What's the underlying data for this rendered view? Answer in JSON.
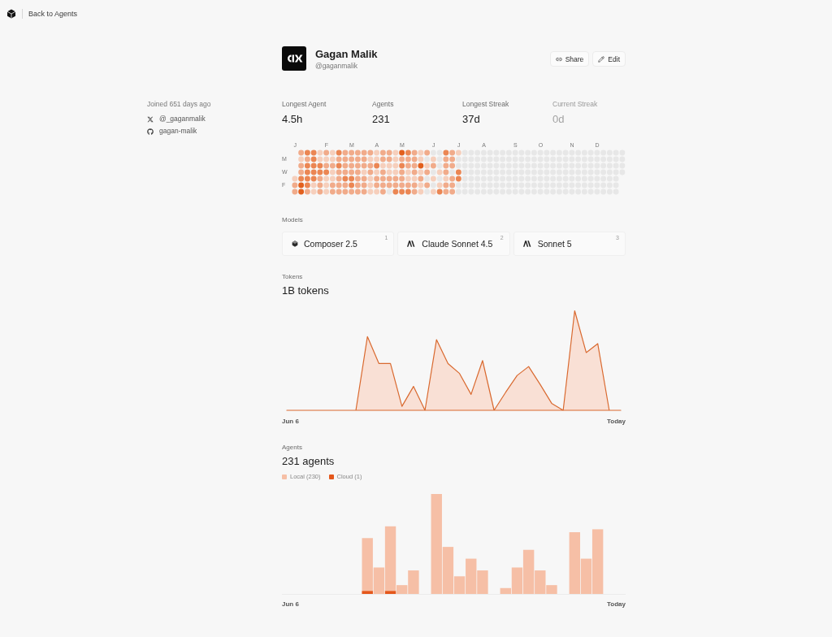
{
  "nav": {
    "back_link": "Back to Agents"
  },
  "profile": {
    "name": "Gagan Malik",
    "handle": "@gaganmalik",
    "actions": [
      {
        "kind": "link",
        "label": "Share"
      },
      {
        "kind": "pencil",
        "label": "Edit"
      }
    ]
  },
  "sidebar": {
    "joined": "Joined 651 days ago",
    "accounts": [
      {
        "kind": "x",
        "handle": "@_gaganmalik"
      },
      {
        "kind": "github",
        "handle": "gagan-malik"
      }
    ]
  },
  "stats": [
    {
      "label": "Longest Agent",
      "value": "4.5h",
      "dimmed": false
    },
    {
      "label": "Agents",
      "value": "231",
      "dimmed": false
    },
    {
      "label": "Longest Streak",
      "value": "37d",
      "dimmed": false
    },
    {
      "label": "Current Streak",
      "value": "0d",
      "dimmed": true
    }
  ],
  "heatmap": {
    "day_labels": [
      "M",
      "W",
      "F"
    ],
    "weeks": [
      {
        "month": "J",
        "days": [
          {
            "color": "#f6cfbc"
          },
          {
            "color": "#f1ab8a"
          },
          {
            "color": "#f1ab8a"
          }
        ]
      },
      {
        "days": [
          {
            "color": "#f1ab8a"
          },
          {
            "color": "#f6cfbc"
          },
          {
            "color": "#f1ab8a"
          },
          {
            "color": "#f1ab8a"
          },
          {
            "color": "#eb8653"
          },
          {
            "color": "#e2601e"
          },
          {
            "color": "#e2601e"
          }
        ]
      },
      {
        "days": [
          {
            "color": "#eb8653"
          },
          {
            "color": "#f1ab8a"
          },
          {
            "color": "#eb8653"
          },
          {
            "color": "#eb8653"
          },
          {
            "color": "#eb8653"
          },
          {
            "color": "#eb8653"
          },
          {
            "color": "#f1ab8a"
          }
        ]
      },
      {
        "days": [
          {
            "color": "#eb8653"
          },
          {
            "color": "#eb8653"
          },
          {
            "color": "#eb8653"
          },
          {
            "color": "#eb8653"
          },
          {
            "color": "#eb8653"
          },
          {
            "color": "#f6cfbc"
          },
          {
            "color": "#f6cfbc"
          }
        ]
      },
      {
        "days": [
          {
            "color": "#f6cfbc"
          },
          {
            "color": "#f6cfbc"
          },
          {
            "color": "#eb8653"
          },
          {
            "color": "#eb8653"
          },
          {
            "color": "#f1ab8a"
          },
          {
            "color": "#f1ab8a"
          },
          {
            "color": "#f1ab8a"
          }
        ]
      },
      {
        "month": "F",
        "days": [
          {
            "color": "#f1ab8a"
          },
          {
            "color": "#f6cfbc"
          },
          {
            "color": "#f1ab8a"
          },
          {
            "color": "#eb8653"
          },
          {
            "color": "#f6cfbc"
          },
          {
            "color": "#f6cfbc"
          },
          {
            "color": "#f6cfbc"
          }
        ]
      },
      {
        "days": [
          {
            "color": "#f6cfbc"
          },
          {
            "color": "#f6cfbc"
          },
          {
            "color": "#f1ab8a"
          },
          {
            "color": "#f6cfbc"
          },
          {
            "color": "#f6cfbc"
          },
          {
            "color": "#f1ab8a"
          },
          {
            "color": "#f1ab8a"
          }
        ]
      },
      {
        "days": [
          {
            "color": "#eb8653"
          },
          {
            "color": "#f1ab8a"
          },
          {
            "color": "#eb8653"
          },
          {
            "color": "#f1ab8a"
          },
          {
            "color": "#f1ab8a"
          },
          {
            "color": "#f1ab8a"
          },
          {
            "color": "#f1ab8a"
          }
        ]
      },
      {
        "days": [
          {
            "color": "#f1ab8a"
          },
          {
            "color": "#f1ab8a"
          },
          {
            "color": "#f1ab8a"
          },
          {
            "color": "#f1ab8a"
          },
          {
            "color": "#eb8653"
          },
          {
            "color": "#f1ab8a"
          },
          {
            "color": "#f1ab8a"
          }
        ]
      },
      {
        "month": "M",
        "days": [
          {
            "color": "#f1ab8a"
          },
          {
            "color": "#f1ab8a"
          },
          {
            "color": "#f1ab8a"
          },
          {
            "color": "#f1ab8a"
          },
          {
            "color": "#eb8653"
          },
          {
            "color": "#eb8653"
          },
          {
            "color": "#f1ab8a"
          }
        ]
      },
      {
        "days": [
          {
            "color": "#f1ab8a"
          },
          {
            "color": "#f1ab8a"
          },
          {
            "color": "#f1ab8a"
          },
          {
            "color": "#f1ab8a"
          },
          {
            "color": "#f1ab8a"
          },
          {
            "color": "#f1ab8a"
          },
          {
            "color": "#f1ab8a"
          }
        ]
      },
      {
        "days": [
          {
            "color": "#f1ab8a"
          },
          {
            "color": "#f1ab8a"
          },
          {
            "color": "#f1ab8a"
          },
          {
            "color": "#f6cfbc"
          },
          {
            "color": "#f1ab8a"
          },
          {
            "color": "#f1ab8a"
          },
          {
            "color": "#f1ab8a"
          }
        ]
      },
      {
        "days": [
          {
            "color": "#f1ab8a"
          },
          {
            "color": "#f6cfbc"
          },
          {
            "color": "#f1ab8a"
          },
          {
            "color": "#f1ab8a"
          },
          {
            "color": "#f6cfbc"
          },
          {
            "color": "#f6cfbc"
          },
          {
            "color": "#f6cfbc"
          }
        ]
      },
      {
        "month": "A",
        "days": [
          {
            "color": "#f6cfbc"
          },
          {
            "color": "#f6cfbc"
          },
          {
            "color": "#eb8653"
          },
          {
            "color": "#f6cfbc"
          },
          {
            "color": "#f1ab8a"
          },
          {
            "color": "#f1ab8a"
          },
          {
            "color": "#f6cfbc"
          }
        ]
      },
      {
        "days": [
          {
            "color": "#f1ab8a"
          },
          {
            "color": "#f1ab8a"
          },
          {
            "color": "#f6cfbc"
          },
          {
            "color": "#f1ab8a"
          },
          {
            "color": "#f1ab8a"
          },
          {
            "color": "#f1ab8a"
          },
          {
            "color": "#f1ab8a"
          }
        ]
      },
      {
        "days": [
          {
            "color": "#f1ab8a"
          },
          {
            "color": "#f1ab8a"
          },
          {
            "color": "#f6cfbc"
          },
          {
            "color": "#f6cfbc"
          },
          {
            "color": "#f1ab8a"
          },
          {
            "color": "#f1ab8a"
          },
          {
            "color": "#e7e7e7"
          }
        ]
      },
      {
        "days": [
          {
            "color": "#f6cfbc"
          },
          {
            "color": "#f6cfbc"
          },
          {
            "color": "#f6cfbc"
          },
          {
            "color": "#f6cfbc"
          },
          {
            "color": "#f1ab8a"
          },
          {
            "color": "#f1ab8a"
          },
          {
            "color": "#eb8653"
          }
        ]
      },
      {
        "month": "M",
        "days": [
          {
            "color": "#e2601e"
          },
          {
            "color": "#f1ab8a"
          },
          {
            "color": "#eb8653"
          },
          {
            "color": "#f1ab8a"
          },
          {
            "color": "#f1ab8a"
          },
          {
            "color": "#f1ab8a"
          },
          {
            "color": "#eb8653"
          }
        ]
      },
      {
        "days": [
          {
            "color": "#eb8653"
          },
          {
            "color": "#f1ab8a"
          },
          {
            "color": "#f1ab8a"
          },
          {
            "color": "#f6cfbc"
          },
          {
            "color": "#f6cfbc"
          },
          {
            "color": "#f1ab8a"
          },
          {
            "color": "#eb8653"
          }
        ]
      },
      {
        "days": [
          {
            "color": "#f1ab8a"
          },
          {
            "color": "#f1ab8a"
          },
          {
            "color": "#f1ab8a"
          },
          {
            "color": "#f1ab8a"
          },
          {
            "color": "#f6cfbc"
          },
          {
            "color": "#f1ab8a"
          },
          {
            "color": "#f1ab8a"
          }
        ]
      },
      {
        "days": [
          {
            "color": "#f6cfbc"
          },
          {
            "color": "#f6cfbc"
          },
          {
            "color": "#e2601e"
          },
          {
            "color": "#f6cfbc"
          },
          {
            "color": "#f1ab8a"
          },
          {
            "color": "#f6cfbc"
          },
          {
            "color": "#f6cfbc"
          }
        ]
      },
      {
        "days": [
          {
            "color": "#f1ab8a"
          },
          {
            "color": "#e7e7e7"
          },
          {
            "color": "#f6cfbc"
          },
          {
            "color": "#f1ab8a"
          },
          {
            "color": "#e7e7e7"
          },
          {
            "color": "#f1ab8a"
          },
          {
            "color": "#e7e7e7"
          }
        ]
      },
      {
        "month": "J",
        "days": [
          {
            "color": "#e7e7e7"
          },
          {
            "color": "#f6cfbc"
          },
          {
            "color": "#f1ab8a"
          },
          {
            "color": "#e7e7e7"
          },
          {
            "color": "#f6cfbc"
          },
          {
            "color": "#e7e7e7"
          },
          {
            "color": "#f6cfbc"
          }
        ]
      },
      {
        "days": [
          {
            "color": "#e7e7e7"
          },
          {
            "color": "#e7e7e7"
          },
          {
            "color": "#e7e7e7"
          },
          {
            "color": "#f6cfbc"
          },
          {
            "color": "#e7e7e7"
          },
          {
            "color": "#f6cfbc"
          },
          {
            "color": "#eb8653"
          }
        ]
      },
      {
        "days": [
          {
            "color": "#eb8653"
          },
          {
            "color": "#f1ab8a"
          },
          {
            "color": "#f1ab8a"
          },
          {
            "color": "#f1ab8a"
          },
          {
            "color": "#f6cfbc"
          },
          {
            "color": "#f1ab8a"
          },
          {
            "color": "#f1ab8a"
          }
        ]
      },
      {
        "days": [
          {
            "color": "#f1ab8a"
          },
          {
            "color": "#f1ab8a"
          },
          {
            "color": "#f1ab8a"
          },
          {
            "color": "#e7e7e7"
          },
          {
            "color": "#f1ab8a"
          },
          {
            "color": "#f1ab8a"
          },
          {
            "color": "#f1ab8a"
          }
        ]
      },
      {
        "month": "J",
        "days": [
          {
            "color": "#f6cfbc"
          },
          {
            "color": "#e7e7e7"
          },
          {
            "color": "#e7e7e7"
          },
          {
            "color": "#eb8653"
          },
          {
            "color": "#eb8653"
          },
          {
            "color": "#e7e7e7"
          },
          {
            "color": "#e7e7e7"
          }
        ]
      },
      {
        "days": [
          {
            "color": "#e7e7e7"
          },
          {
            "color": "#e7e7e7"
          },
          {
            "color": "#e7e7e7"
          },
          {
            "color": "#e7e7e7"
          },
          {
            "color": "#e7e7e7"
          },
          {
            "color": "#e7e7e7"
          },
          {
            "color": "#e7e7e7"
          }
        ]
      },
      {
        "days": [
          {
            "color": "#e7e7e7"
          },
          {
            "color": "#e7e7e7"
          },
          {
            "color": "#e7e7e7"
          },
          {
            "color": "#e7e7e7"
          },
          {
            "color": "#e7e7e7"
          },
          {
            "color": "#e7e7e7"
          },
          {
            "color": "#e7e7e7"
          }
        ]
      },
      {
        "days": [
          {
            "color": "#e7e7e7"
          },
          {
            "color": "#e7e7e7"
          },
          {
            "color": "#e7e7e7"
          },
          {
            "color": "#e7e7e7"
          },
          {
            "color": "#e7e7e7"
          },
          {
            "color": "#e7e7e7"
          },
          {
            "color": "#e7e7e7"
          }
        ]
      },
      {
        "month": "A",
        "days": [
          {
            "color": "#e7e7e7"
          },
          {
            "color": "#e7e7e7"
          },
          {
            "color": "#e7e7e7"
          },
          {
            "color": "#e7e7e7"
          },
          {
            "color": "#e7e7e7"
          },
          {
            "color": "#e7e7e7"
          },
          {
            "color": "#e7e7e7"
          }
        ]
      },
      {
        "days": [
          {
            "color": "#e7e7e7"
          },
          {
            "color": "#e7e7e7"
          },
          {
            "color": "#e7e7e7"
          },
          {
            "color": "#e7e7e7"
          },
          {
            "color": "#e7e7e7"
          },
          {
            "color": "#e7e7e7"
          },
          {
            "color": "#e7e7e7"
          }
        ]
      },
      {
        "days": [
          {
            "color": "#e7e7e7"
          },
          {
            "color": "#e7e7e7"
          },
          {
            "color": "#e7e7e7"
          },
          {
            "color": "#e7e7e7"
          },
          {
            "color": "#e7e7e7"
          },
          {
            "color": "#e7e7e7"
          },
          {
            "color": "#e7e7e7"
          }
        ]
      },
      {
        "days": [
          {
            "color": "#e7e7e7"
          },
          {
            "color": "#e7e7e7"
          },
          {
            "color": "#e7e7e7"
          },
          {
            "color": "#e7e7e7"
          },
          {
            "color": "#e7e7e7"
          },
          {
            "color": "#e7e7e7"
          },
          {
            "color": "#e7e7e7"
          }
        ]
      },
      {
        "days": [
          {
            "color": "#e7e7e7"
          },
          {
            "color": "#e7e7e7"
          },
          {
            "color": "#e7e7e7"
          },
          {
            "color": "#e7e7e7"
          },
          {
            "color": "#e7e7e7"
          },
          {
            "color": "#e7e7e7"
          },
          {
            "color": "#e7e7e7"
          }
        ]
      },
      {
        "month": "S",
        "days": [
          {
            "color": "#e7e7e7"
          },
          {
            "color": "#e7e7e7"
          },
          {
            "color": "#e7e7e7"
          },
          {
            "color": "#e7e7e7"
          },
          {
            "color": "#e7e7e7"
          },
          {
            "color": "#e7e7e7"
          },
          {
            "color": "#e7e7e7"
          }
        ]
      },
      {
        "days": [
          {
            "color": "#e7e7e7"
          },
          {
            "color": "#e7e7e7"
          },
          {
            "color": "#e7e7e7"
          },
          {
            "color": "#e7e7e7"
          },
          {
            "color": "#e7e7e7"
          },
          {
            "color": "#e7e7e7"
          },
          {
            "color": "#e7e7e7"
          }
        ]
      },
      {
        "days": [
          {
            "color": "#e7e7e7"
          },
          {
            "color": "#e7e7e7"
          },
          {
            "color": "#e7e7e7"
          },
          {
            "color": "#e7e7e7"
          },
          {
            "color": "#e7e7e7"
          },
          {
            "color": "#e7e7e7"
          },
          {
            "color": "#e7e7e7"
          }
        ]
      },
      {
        "days": [
          {
            "color": "#e7e7e7"
          },
          {
            "color": "#e7e7e7"
          },
          {
            "color": "#e7e7e7"
          },
          {
            "color": "#e7e7e7"
          },
          {
            "color": "#e7e7e7"
          },
          {
            "color": "#e7e7e7"
          },
          {
            "color": "#e7e7e7"
          }
        ]
      },
      {
        "month": "O",
        "days": [
          {
            "color": "#e7e7e7"
          },
          {
            "color": "#e7e7e7"
          },
          {
            "color": "#e7e7e7"
          },
          {
            "color": "#e7e7e7"
          },
          {
            "color": "#e7e7e7"
          },
          {
            "color": "#e7e7e7"
          },
          {
            "color": "#e7e7e7"
          }
        ]
      },
      {
        "days": [
          {
            "color": "#e7e7e7"
          },
          {
            "color": "#e7e7e7"
          },
          {
            "color": "#e7e7e7"
          },
          {
            "color": "#e7e7e7"
          },
          {
            "color": "#e7e7e7"
          },
          {
            "color": "#e7e7e7"
          },
          {
            "color": "#e7e7e7"
          }
        ]
      },
      {
        "days": [
          {
            "color": "#e7e7e7"
          },
          {
            "color": "#e7e7e7"
          },
          {
            "color": "#e7e7e7"
          },
          {
            "color": "#e7e7e7"
          },
          {
            "color": "#e7e7e7"
          },
          {
            "color": "#e7e7e7"
          },
          {
            "color": "#e7e7e7"
          }
        ]
      },
      {
        "days": [
          {
            "color": "#e7e7e7"
          },
          {
            "color": "#e7e7e7"
          },
          {
            "color": "#e7e7e7"
          },
          {
            "color": "#e7e7e7"
          },
          {
            "color": "#e7e7e7"
          },
          {
            "color": "#e7e7e7"
          },
          {
            "color": "#e7e7e7"
          }
        ]
      },
      {
        "days": [
          {
            "color": "#e7e7e7"
          },
          {
            "color": "#e7e7e7"
          },
          {
            "color": "#e7e7e7"
          },
          {
            "color": "#e7e7e7"
          },
          {
            "color": "#e7e7e7"
          },
          {
            "color": "#e7e7e7"
          },
          {
            "color": "#e7e7e7"
          }
        ]
      },
      {
        "month": "N",
        "days": [
          {
            "color": "#e7e7e7"
          },
          {
            "color": "#e7e7e7"
          },
          {
            "color": "#e7e7e7"
          },
          {
            "color": "#e7e7e7"
          },
          {
            "color": "#e7e7e7"
          },
          {
            "color": "#e7e7e7"
          },
          {
            "color": "#e7e7e7"
          }
        ]
      },
      {
        "days": [
          {
            "color": "#e7e7e7"
          },
          {
            "color": "#e7e7e7"
          },
          {
            "color": "#e7e7e7"
          },
          {
            "color": "#e7e7e7"
          },
          {
            "color": "#e7e7e7"
          },
          {
            "color": "#e7e7e7"
          },
          {
            "color": "#e7e7e7"
          }
        ]
      },
      {
        "days": [
          {
            "color": "#e7e7e7"
          },
          {
            "color": "#e7e7e7"
          },
          {
            "color": "#e7e7e7"
          },
          {
            "color": "#e7e7e7"
          },
          {
            "color": "#e7e7e7"
          },
          {
            "color": "#e7e7e7"
          },
          {
            "color": "#e7e7e7"
          }
        ]
      },
      {
        "days": [
          {
            "color": "#e7e7e7"
          },
          {
            "color": "#e7e7e7"
          },
          {
            "color": "#e7e7e7"
          },
          {
            "color": "#e7e7e7"
          },
          {
            "color": "#e7e7e7"
          },
          {
            "color": "#e7e7e7"
          },
          {
            "color": "#e7e7e7"
          }
        ]
      },
      {
        "month": "D",
        "days": [
          {
            "color": "#e7e7e7"
          },
          {
            "color": "#e7e7e7"
          },
          {
            "color": "#e7e7e7"
          },
          {
            "color": "#e7e7e7"
          },
          {
            "color": "#e7e7e7"
          },
          {
            "color": "#e7e7e7"
          },
          {
            "color": "#e7e7e7"
          }
        ]
      },
      {
        "days": [
          {
            "color": "#e7e7e7"
          },
          {
            "color": "#e7e7e7"
          },
          {
            "color": "#e7e7e7"
          },
          {
            "color": "#e7e7e7"
          },
          {
            "color": "#e7e7e7"
          },
          {
            "color": "#e7e7e7"
          },
          {
            "color": "#e7e7e7"
          }
        ]
      },
      {
        "days": [
          {
            "color": "#e7e7e7"
          },
          {
            "color": "#e7e7e7"
          },
          {
            "color": "#e7e7e7"
          },
          {
            "color": "#e7e7e7"
          },
          {
            "color": "#e7e7e7"
          },
          {
            "color": "#e7e7e7"
          },
          {
            "color": "#e7e7e7"
          }
        ]
      },
      {
        "days": [
          {
            "color": "#e7e7e7"
          },
          {
            "color": "#e7e7e7"
          },
          {
            "color": "#e7e7e7"
          },
          {
            "color": "#e7e7e7"
          },
          {
            "color": "#e7e7e7"
          },
          {
            "color": "#e7e7e7"
          },
          {
            "color": "#e7e7e7"
          }
        ]
      },
      {
        "days": [
          {
            "color": "#e7e7e7"
          },
          {
            "color": "#e7e7e7"
          },
          {
            "color": "#e7e7e7"
          },
          {
            "color": "#e7e7e7"
          }
        ]
      }
    ]
  },
  "models": {
    "label": "Models",
    "items": [
      {
        "kind": "cube",
        "name": "Composer 2.5",
        "rank": "1"
      },
      {
        "kind": "anthropic",
        "name": "Claude Sonnet 4.5",
        "rank": "2"
      },
      {
        "kind": "anthropic",
        "name": "Sonnet 5",
        "rank": "3"
      }
    ]
  },
  "tokens": {
    "label": "Tokens",
    "total": "1B tokens",
    "axis_labels": [
      "Jun 6",
      "Today"
    ]
  },
  "agents": {
    "label": "Agents",
    "total": "231 agents",
    "legend": [
      {
        "name": "Local (230)",
        "color": "#f6bfa6"
      },
      {
        "name": "Cloud (1)",
        "color": "#e4571b"
      }
    ],
    "axis_labels": [
      "Jun 6",
      "Today"
    ]
  }
}
